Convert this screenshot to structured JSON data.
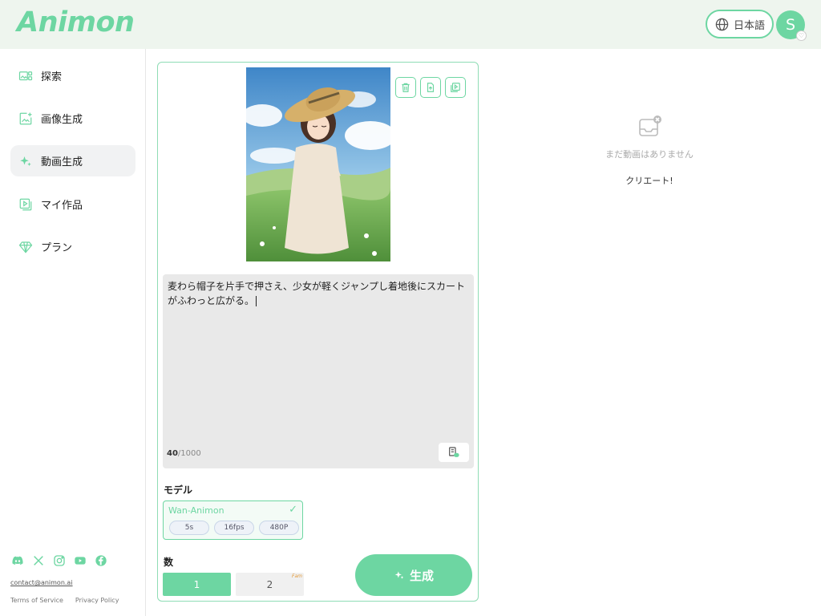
{
  "app": {
    "logo": "Animon"
  },
  "header": {
    "language_label": "日本語",
    "avatar_initial": "S"
  },
  "sidebar": {
    "items": [
      {
        "label": "探索",
        "icon": "explore-icon"
      },
      {
        "label": "画像生成",
        "icon": "image-generate-icon"
      },
      {
        "label": "動画生成",
        "icon": "sparkle-icon",
        "active": true
      },
      {
        "label": "マイ作品",
        "icon": "my-works-icon"
      },
      {
        "label": "プラン",
        "icon": "diamond-icon"
      }
    ],
    "social_icons": [
      "discord-icon",
      "x-icon",
      "instagram-icon",
      "youtube-icon",
      "facebook-icon"
    ],
    "contact_email": "contact@animon.ai",
    "terms_label": "Terms of Service",
    "privacy_label": "Privacy Policy"
  },
  "editor": {
    "image_tools": [
      "trash-icon",
      "upload-image-icon",
      "video-library-icon"
    ],
    "prompt": "麦わら帽子を片手で押さえ、少女が軽くジャンプし着地後にスカートがふわっと広がる。",
    "char_count": "40",
    "char_limit": "/1000",
    "model_section_label": "モデル",
    "model": {
      "name": "Wan-Animon",
      "check": "✓",
      "chips": [
        "5s",
        "16fps",
        "480P"
      ]
    },
    "count_section_label": "数",
    "count_options": [
      "1",
      "2"
    ],
    "count_selected": "1",
    "count_tag": "Fam",
    "generate_label": "生成"
  },
  "empty_state": {
    "message": "まだ動画はありません",
    "create_label": "クリエート!"
  },
  "colors": {
    "accent": "#6dd6a2",
    "header_bg": "#eef5ee",
    "prompt_bg": "#e9e9e9"
  }
}
